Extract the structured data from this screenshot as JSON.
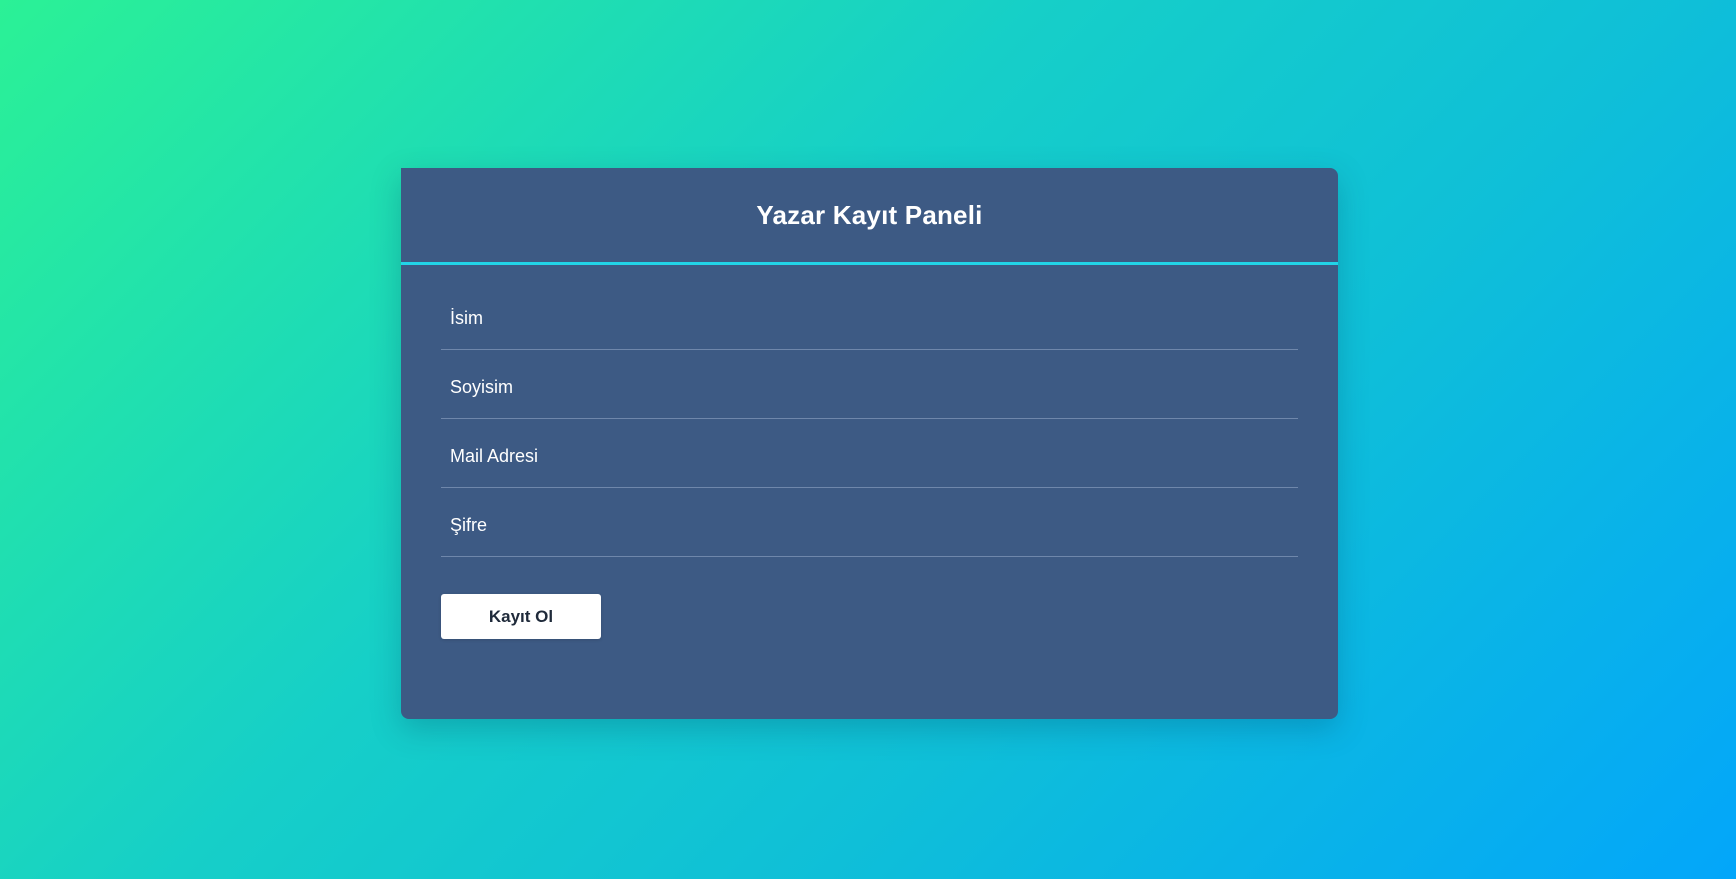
{
  "panel": {
    "title": "Yazar Kayıt Paneli"
  },
  "form": {
    "fields": [
      {
        "name": "first_name",
        "placeholder": "İsim",
        "value": ""
      },
      {
        "name": "last_name",
        "placeholder": "Soyisim",
        "value": ""
      },
      {
        "name": "email",
        "placeholder": "Mail Adresi",
        "value": ""
      },
      {
        "name": "password",
        "placeholder": "Şifre",
        "value": ""
      }
    ],
    "submit_label": "Kayıt Ol"
  },
  "colors": {
    "background_start": "#2bf196",
    "background_end": "#03a6fa",
    "panel": "#3d5a84",
    "header_accent": "#22d4e8",
    "button": "#ffffff"
  }
}
